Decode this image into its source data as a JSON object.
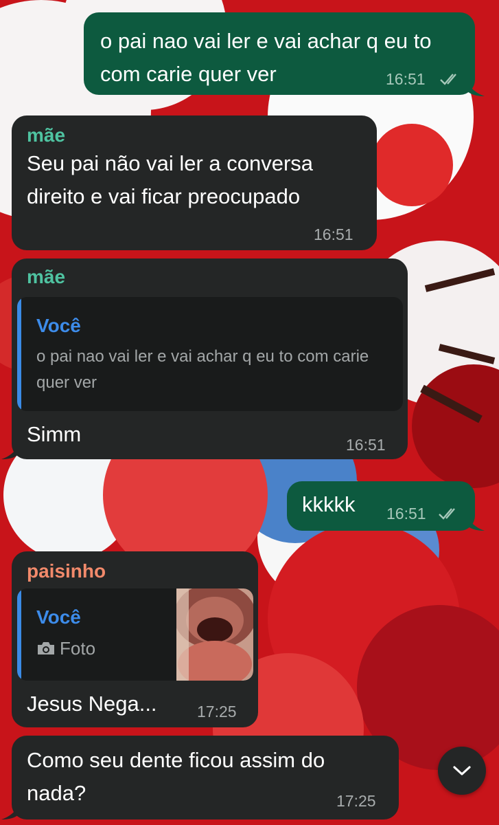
{
  "messages": [
    {
      "direction": "outgoing",
      "text": "o pai nao vai ler e vai achar q eu to com carie quer ver",
      "time": "16:51",
      "status": "read"
    },
    {
      "direction": "incoming",
      "sender": "mãe",
      "text": "Seu pai não vai ler a conversa direito e vai ficar preocupado",
      "time": "16:51"
    },
    {
      "direction": "incoming",
      "sender": "mãe",
      "reply": {
        "author": "Você",
        "text": "o pai nao vai ler e vai achar q eu to com carie quer ver"
      },
      "text": "Simm",
      "time": "16:51"
    },
    {
      "direction": "outgoing",
      "text": "kkkkk",
      "time": "16:51",
      "status": "read"
    },
    {
      "direction": "incoming",
      "sender": "paisinho",
      "reply": {
        "author": "Você",
        "icon": "camera-icon",
        "text": "Foto"
      },
      "text": "Jesus Nega...",
      "time": "17:25"
    },
    {
      "direction": "incoming",
      "text": "Como seu dente ficou assim do nada?",
      "time": "17:25"
    }
  ],
  "scroll_button": {
    "icon": "chevron-down-icon"
  },
  "colors": {
    "incoming_bubble": "#242626",
    "outgoing_bubble": "#0d5a3f",
    "sender_mae": "#4fc3a1",
    "sender_paisinho": "#f28a6b",
    "quote_author": "#3d8cea",
    "wallpaper": "#c8141a"
  }
}
